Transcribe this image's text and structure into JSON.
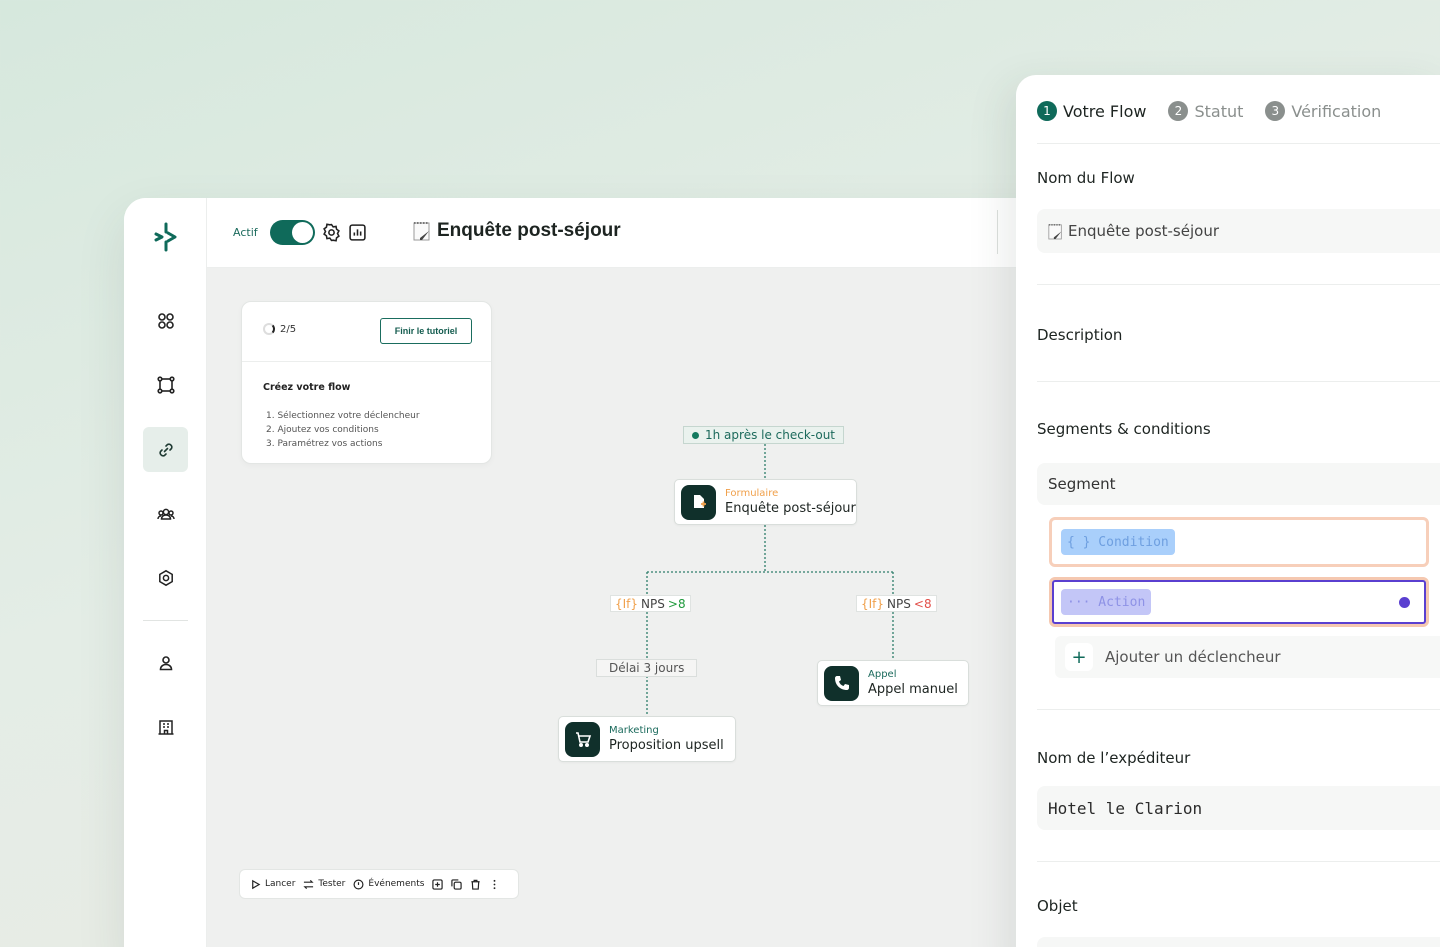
{
  "topbar": {
    "actif_label": "Actif",
    "flow_title": "Enquête post-séjour"
  },
  "tutorial": {
    "progress": "2/5",
    "finish_button": "Finir le tutoriel",
    "title": "Créez votre flow",
    "steps": [
      "1. Sélectionnez votre déclencheur",
      "2. Ajoutez vos conditions",
      "3. Paramétrez vos actions"
    ]
  },
  "flow": {
    "trigger": "1h après le check-out",
    "form_node": {
      "category": "Formulaire",
      "name": "Enquête post-séjour"
    },
    "cond_left": {
      "kw": "{If}",
      "label": "NPS",
      "value": ">8"
    },
    "cond_right": {
      "kw": "{If}",
      "label": "NPS",
      "value": "<8"
    },
    "delay": "Délai 3 jours",
    "call_node": {
      "category": "Appel",
      "name": "Appel manuel"
    },
    "marketing_node": {
      "category": "Marketing",
      "name": "Proposition upsell"
    }
  },
  "toolbar": {
    "launch": "Lancer",
    "test": "Tester",
    "events": "Événements"
  },
  "panel": {
    "steps": [
      {
        "num": "1",
        "label": "Votre Flow"
      },
      {
        "num": "2",
        "label": "Statut"
      },
      {
        "num": "3",
        "label": "Vérification"
      }
    ],
    "flow_name_label": "Nom du Flow",
    "flow_name_value": "Enquête post-séjour",
    "description_label": "Description",
    "segments_label": "Segments & conditions",
    "segment_label": "Segment",
    "condition_chip": "{ } Condition",
    "action_chip": "··· Action",
    "add_trigger": "Ajouter un déclencheur",
    "sender_label": "Nom de l’expéditeur",
    "sender_value": "Hotel le Clarion",
    "subject_label": "Objet"
  },
  "colors": {
    "brand": "#0f6a5a",
    "nps_positive": "#1f9a3c",
    "nps_negative": "#e2504a",
    "form_category": "#f0a04b",
    "call_category": "#1b6a5c",
    "action_selected": "#5a3fd0"
  },
  "icons": {
    "sidebar": [
      "grid-icon",
      "frame-icon",
      "link-icon",
      "users-icon",
      "settings-icon",
      "user-icon",
      "building-icon"
    ]
  }
}
